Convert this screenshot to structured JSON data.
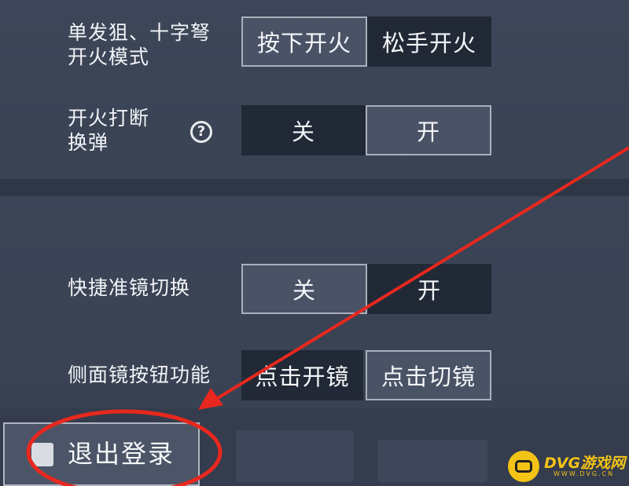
{
  "settings": {
    "fire_mode": {
      "label_line1": "单发狙、十字弩",
      "label_line2": "开火模式",
      "options": [
        "按下开火",
        "松手开火"
      ],
      "selected": "按下开火"
    },
    "fire_interrupt_reload": {
      "label_line1": "开火打断",
      "label_line2": "换弹",
      "help_icon": "question-circle-icon",
      "help_glyph": "?",
      "options": [
        "关",
        "开"
      ],
      "selected": "开"
    },
    "quick_scope_switch": {
      "label": "快捷准镜切换",
      "options": [
        "关",
        "开"
      ],
      "selected": "关"
    },
    "side_scope_button": {
      "label": "侧面镜按钮功能",
      "options": [
        "点击开镜",
        "点击切镜"
      ],
      "selected": "点击切镜"
    }
  },
  "logout": {
    "label": "退出登录",
    "icon": "logout-icon"
  },
  "annotation": {
    "color": "#e8281e",
    "description_shapes": [
      "arrow",
      "ellipse"
    ]
  },
  "watermark": {
    "title": "DVG游戏网",
    "url": "WWW.DVG.CN",
    "color": "#f3c316"
  },
  "colors": {
    "background": "#3b4456",
    "selected_option": "#4a5366",
    "unselected_option": "#222936"
  }
}
